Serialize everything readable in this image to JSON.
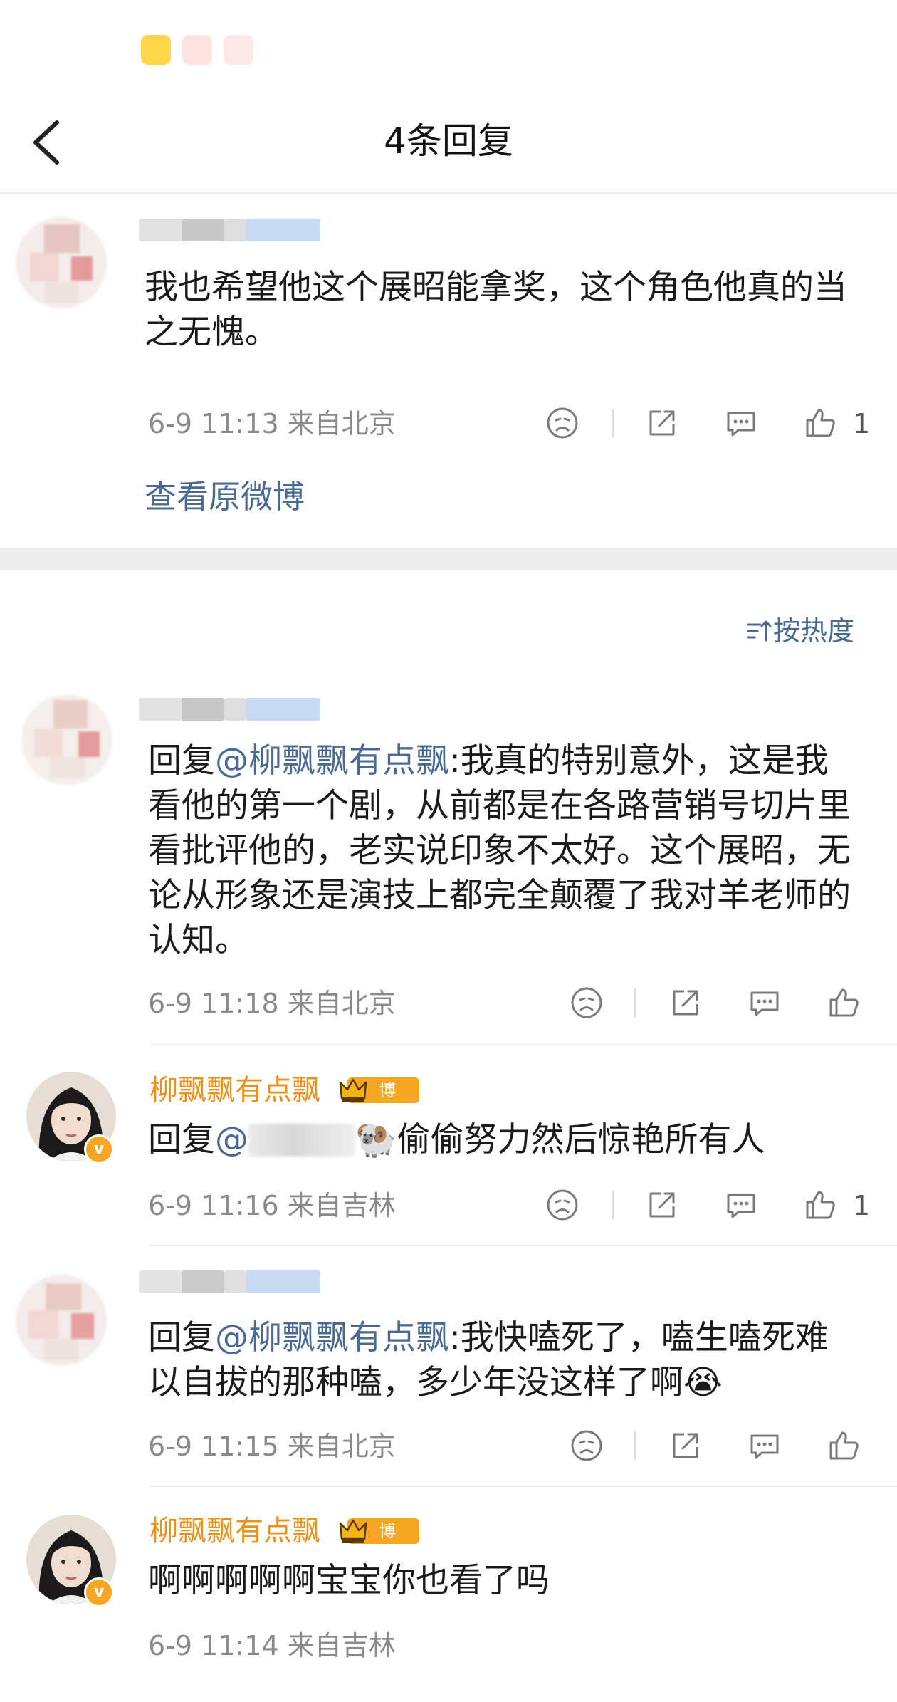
{
  "header": {
    "title": "4条回复"
  },
  "status_apps": [
    "weibo-app-icon",
    "shopping-618-icon",
    "red-app-icon"
  ],
  "original": {
    "text": "我也希望他这个展昭能拿奖，这个角色他真的当之无愧。",
    "meta": "6-9 11:13 来自北京",
    "likes": "1",
    "view_original": "查看原微博"
  },
  "sort": {
    "label": "按热度"
  },
  "replies": [
    {
      "prefix": "回复",
      "mention": "@柳飘飘有点飘",
      "body": ":我真的特别意外，这是我看他的第一个剧，从前都是在各路营销号切片里看批评他的，老实说印象不太好。这个展昭，无论从形象还是演技上都完全颠覆了我对羊老师的认知。",
      "meta": "6-9 11:18 来自北京"
    },
    {
      "author": "柳飘飘有点飘",
      "badge": "博主",
      "prefix": "回复",
      "mention": "@",
      "emoji": "🐏",
      "body": "偷偷努力然后惊艳所有人",
      "meta": "6-9 11:16 来自吉林",
      "likes": "1"
    },
    {
      "prefix": "回复",
      "mention": "@柳飘飘有点飘",
      "body": ":我快嗑死了，嗑生嗑死难以自拔的那种嗑，多少年没这样了啊",
      "emoji": "😭",
      "meta": "6-9 11:15 来自北京"
    },
    {
      "author": "柳飘飘有点飘",
      "badge": "博主",
      "body": "啊啊啊啊啊宝宝你也看了吗",
      "meta": "6-9 11:14 来自吉林"
    }
  ],
  "colors": {
    "link": "#4a6a96",
    "blogger_name": "#f08f1a",
    "badge": "#f5a623",
    "meta": "#8a8a8a"
  }
}
